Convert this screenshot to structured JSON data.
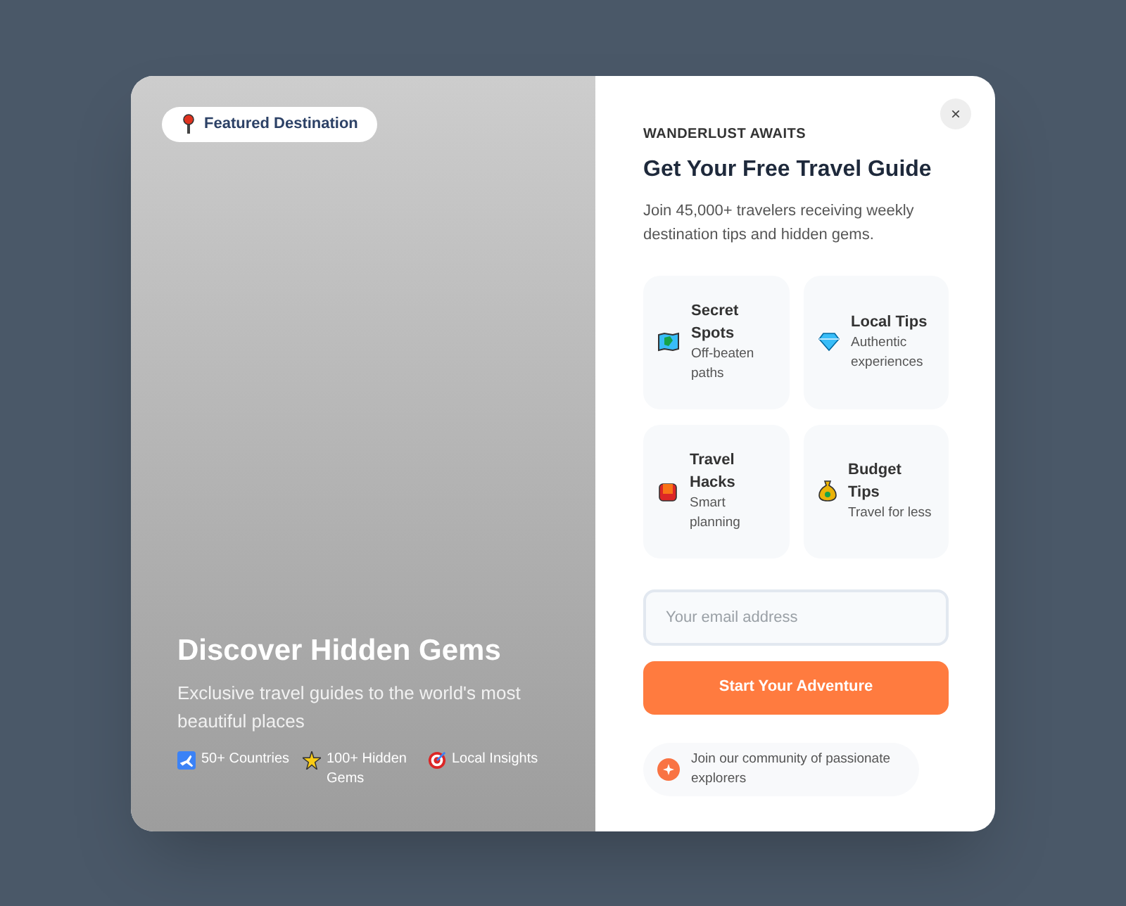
{
  "badge": "Featured Destination",
  "hero": {
    "title": "Discover Hidden Gems",
    "subtitle": "Exclusive travel guides to the world's most beautiful places",
    "stats": [
      {
        "label": "50+ Countries"
      },
      {
        "label": "100+ Hidden Gems"
      },
      {
        "label": "Local Insights"
      }
    ]
  },
  "close": "×",
  "eyebrow": "WANDERLUST AWAITS",
  "title": "Get Your Free Travel Guide",
  "description": "Join 45,000+ travelers receiving weekly destination tips and hidden gems.",
  "features": [
    {
      "title": "Secret Spots",
      "text": "Off-beaten paths"
    },
    {
      "title": "Local Tips",
      "text": "Authentic experiences"
    },
    {
      "title": "Travel Hacks",
      "text": "Smart planning"
    },
    {
      "title": "Budget Tips",
      "text": "Travel for less"
    }
  ],
  "email": {
    "placeholder": "Your email address"
  },
  "submit": "Start Your Adventure",
  "community": "Join our community of passionate explorers"
}
